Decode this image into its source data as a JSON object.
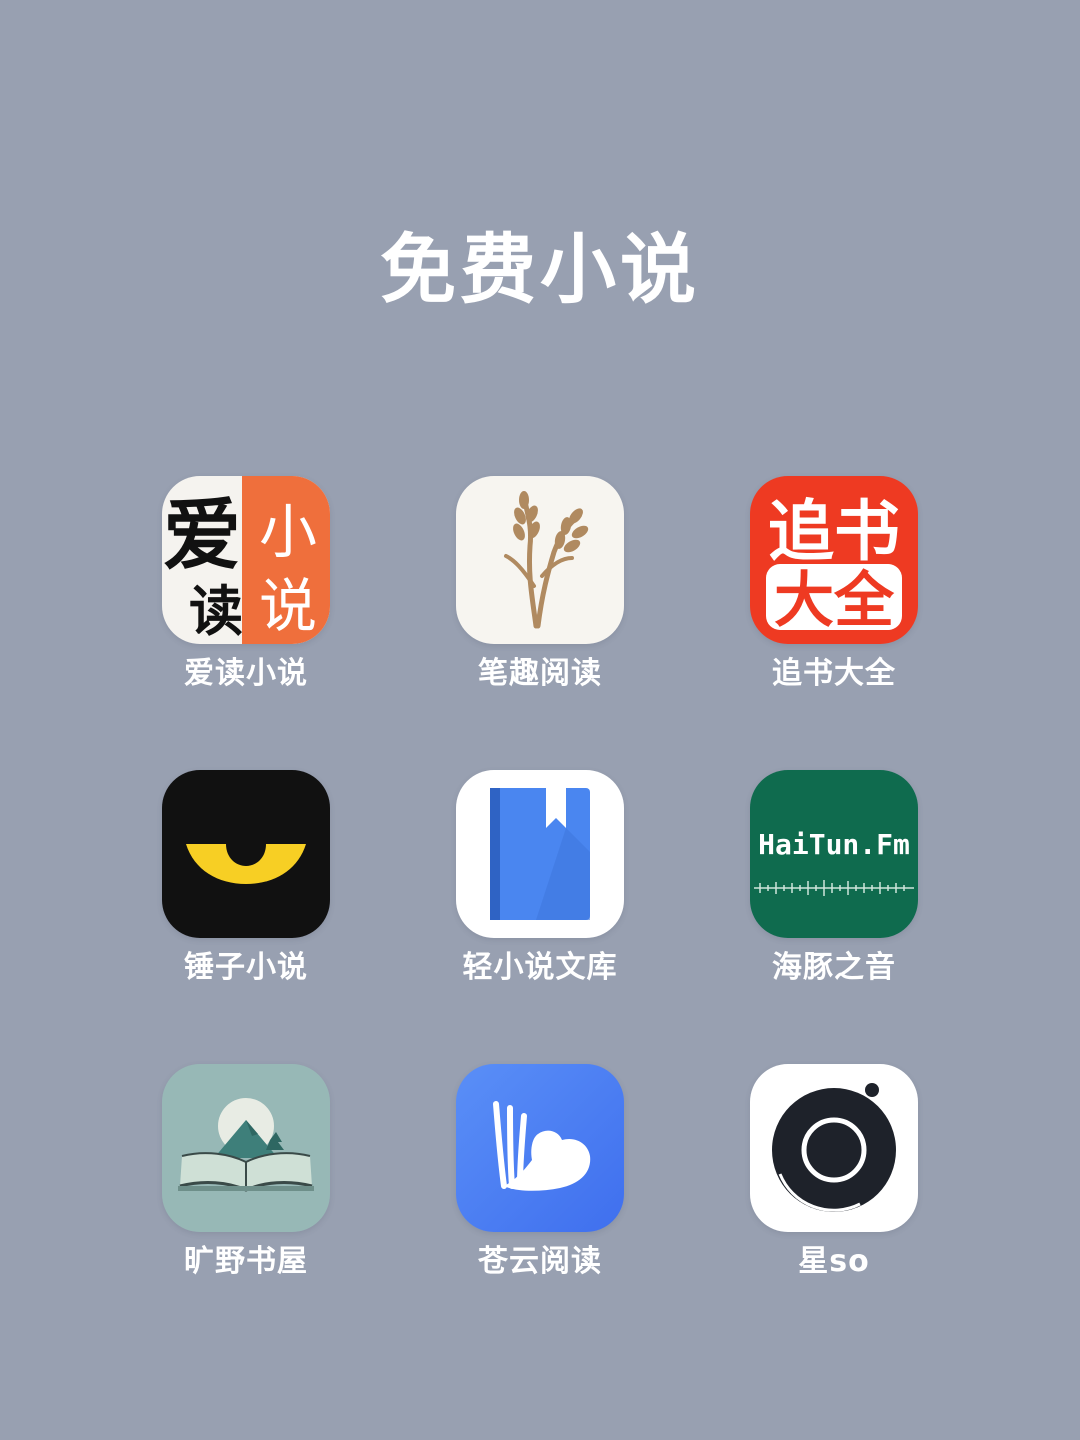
{
  "page": {
    "title": "免费小说"
  },
  "apps": [
    {
      "name": "爱读小说",
      "icon": "aidu-xiaoshuo-logo",
      "icon_text": [
        "爱",
        "读",
        "小",
        "说"
      ]
    },
    {
      "name": "笔趣阅读",
      "icon": "wheat-icon"
    },
    {
      "name": "追书大全",
      "icon": "zhuishu-daquan-logo",
      "icon_text": [
        "追书",
        "大全"
      ]
    },
    {
      "name": "锤子小说",
      "icon": "yellow-eye-icon"
    },
    {
      "name": "轻小说文库",
      "icon": "bookmark-book-icon"
    },
    {
      "name": "海豚之音",
      "icon": "haitun-fm-logo",
      "icon_text": [
        "HaiTun.Fm"
      ]
    },
    {
      "name": "旷野书屋",
      "icon": "mountain-open-book-icon"
    },
    {
      "name": "苍云阅读",
      "icon": "cloud-book-icon"
    },
    {
      "name": "星so",
      "icon": "camera-lens-icon"
    }
  ],
  "colors": {
    "background": "#98a0b1",
    "aidu_orange": "#ef6f3c",
    "zhuishu_red": "#ee3a22",
    "chuizi_yellow": "#f7cf24",
    "qing_blue": "#4a86f0",
    "haitun_green": "#0f6b4e",
    "kuangye_teal": "#97b8b6",
    "cangyun_blue": "#4a80f5"
  }
}
